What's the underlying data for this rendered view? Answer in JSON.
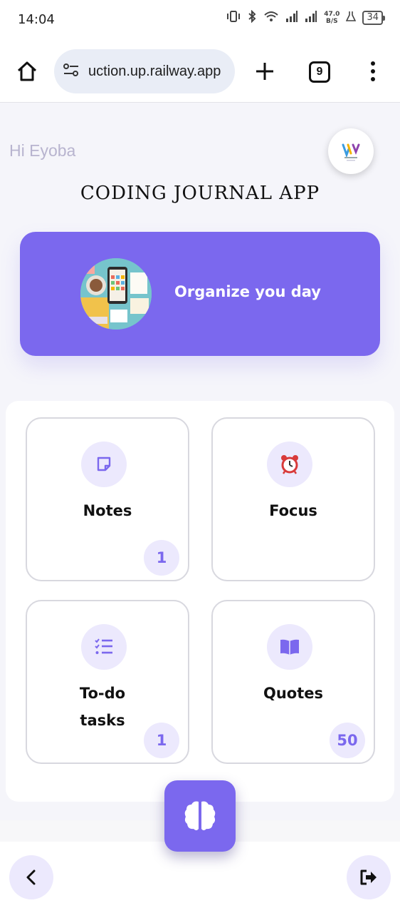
{
  "status_bar": {
    "time": "14:04",
    "net_speed_value": "47.0",
    "net_speed_unit": "B/S",
    "battery": "34"
  },
  "browser": {
    "url": "uction.up.railway.app",
    "tab_count": "9"
  },
  "page": {
    "greeting": "Hi Eyoba",
    "title": "CODING JOURNAL APP",
    "banner_text": "Organize you day",
    "cards": [
      {
        "label": "Notes",
        "badge": "1",
        "icon": "note-icon"
      },
      {
        "label": "Focus",
        "badge": "",
        "icon": "alarm-clock-icon"
      },
      {
        "label": "To-do tasks",
        "badge": "1",
        "icon": "checklist-icon"
      },
      {
        "label": "Quotes",
        "badge": "50",
        "icon": "book-icon"
      }
    ]
  },
  "colors": {
    "accent": "#7b68ee",
    "accent_light": "#ece9fd",
    "greeting": "#b8b4cf"
  }
}
